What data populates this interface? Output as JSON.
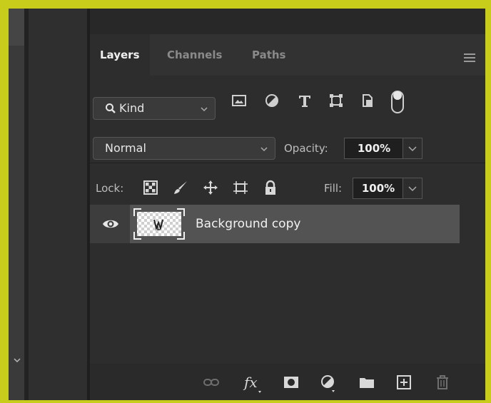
{
  "tabs": [
    "Layers",
    "Channels",
    "Paths"
  ],
  "filter": {
    "kind_label": "Kind"
  },
  "blend": {
    "mode": "Normal",
    "opacity_label": "Opacity:",
    "opacity_value": "100%"
  },
  "lock": {
    "label": "Lock:",
    "fill_label": "Fill:",
    "fill_value": "100%"
  },
  "layers": [
    {
      "name": "Background copy",
      "visible": true
    }
  ],
  "icons": {
    "filter": [
      "search-icon",
      "image-filter-icon",
      "adjustment-filter-icon",
      "type-filter-icon",
      "shape-filter-icon",
      "smart-object-filter-icon",
      "filter-toggle-icon"
    ],
    "lock": [
      "lock-transparent-pixels-icon",
      "lock-image-pixels-icon",
      "lock-position-icon",
      "lock-artboard-icon",
      "lock-all-icon"
    ],
    "bottom": [
      "link-layers-icon",
      "fx-icon",
      "add-mask-icon",
      "adjustment-layer-icon",
      "new-group-icon",
      "new-layer-icon",
      "delete-layer-icon"
    ]
  },
  "colors": {
    "highlight_border": "#c8cd1c",
    "panel_bg": "#2d2d2d",
    "selected_layer": "#535353"
  }
}
